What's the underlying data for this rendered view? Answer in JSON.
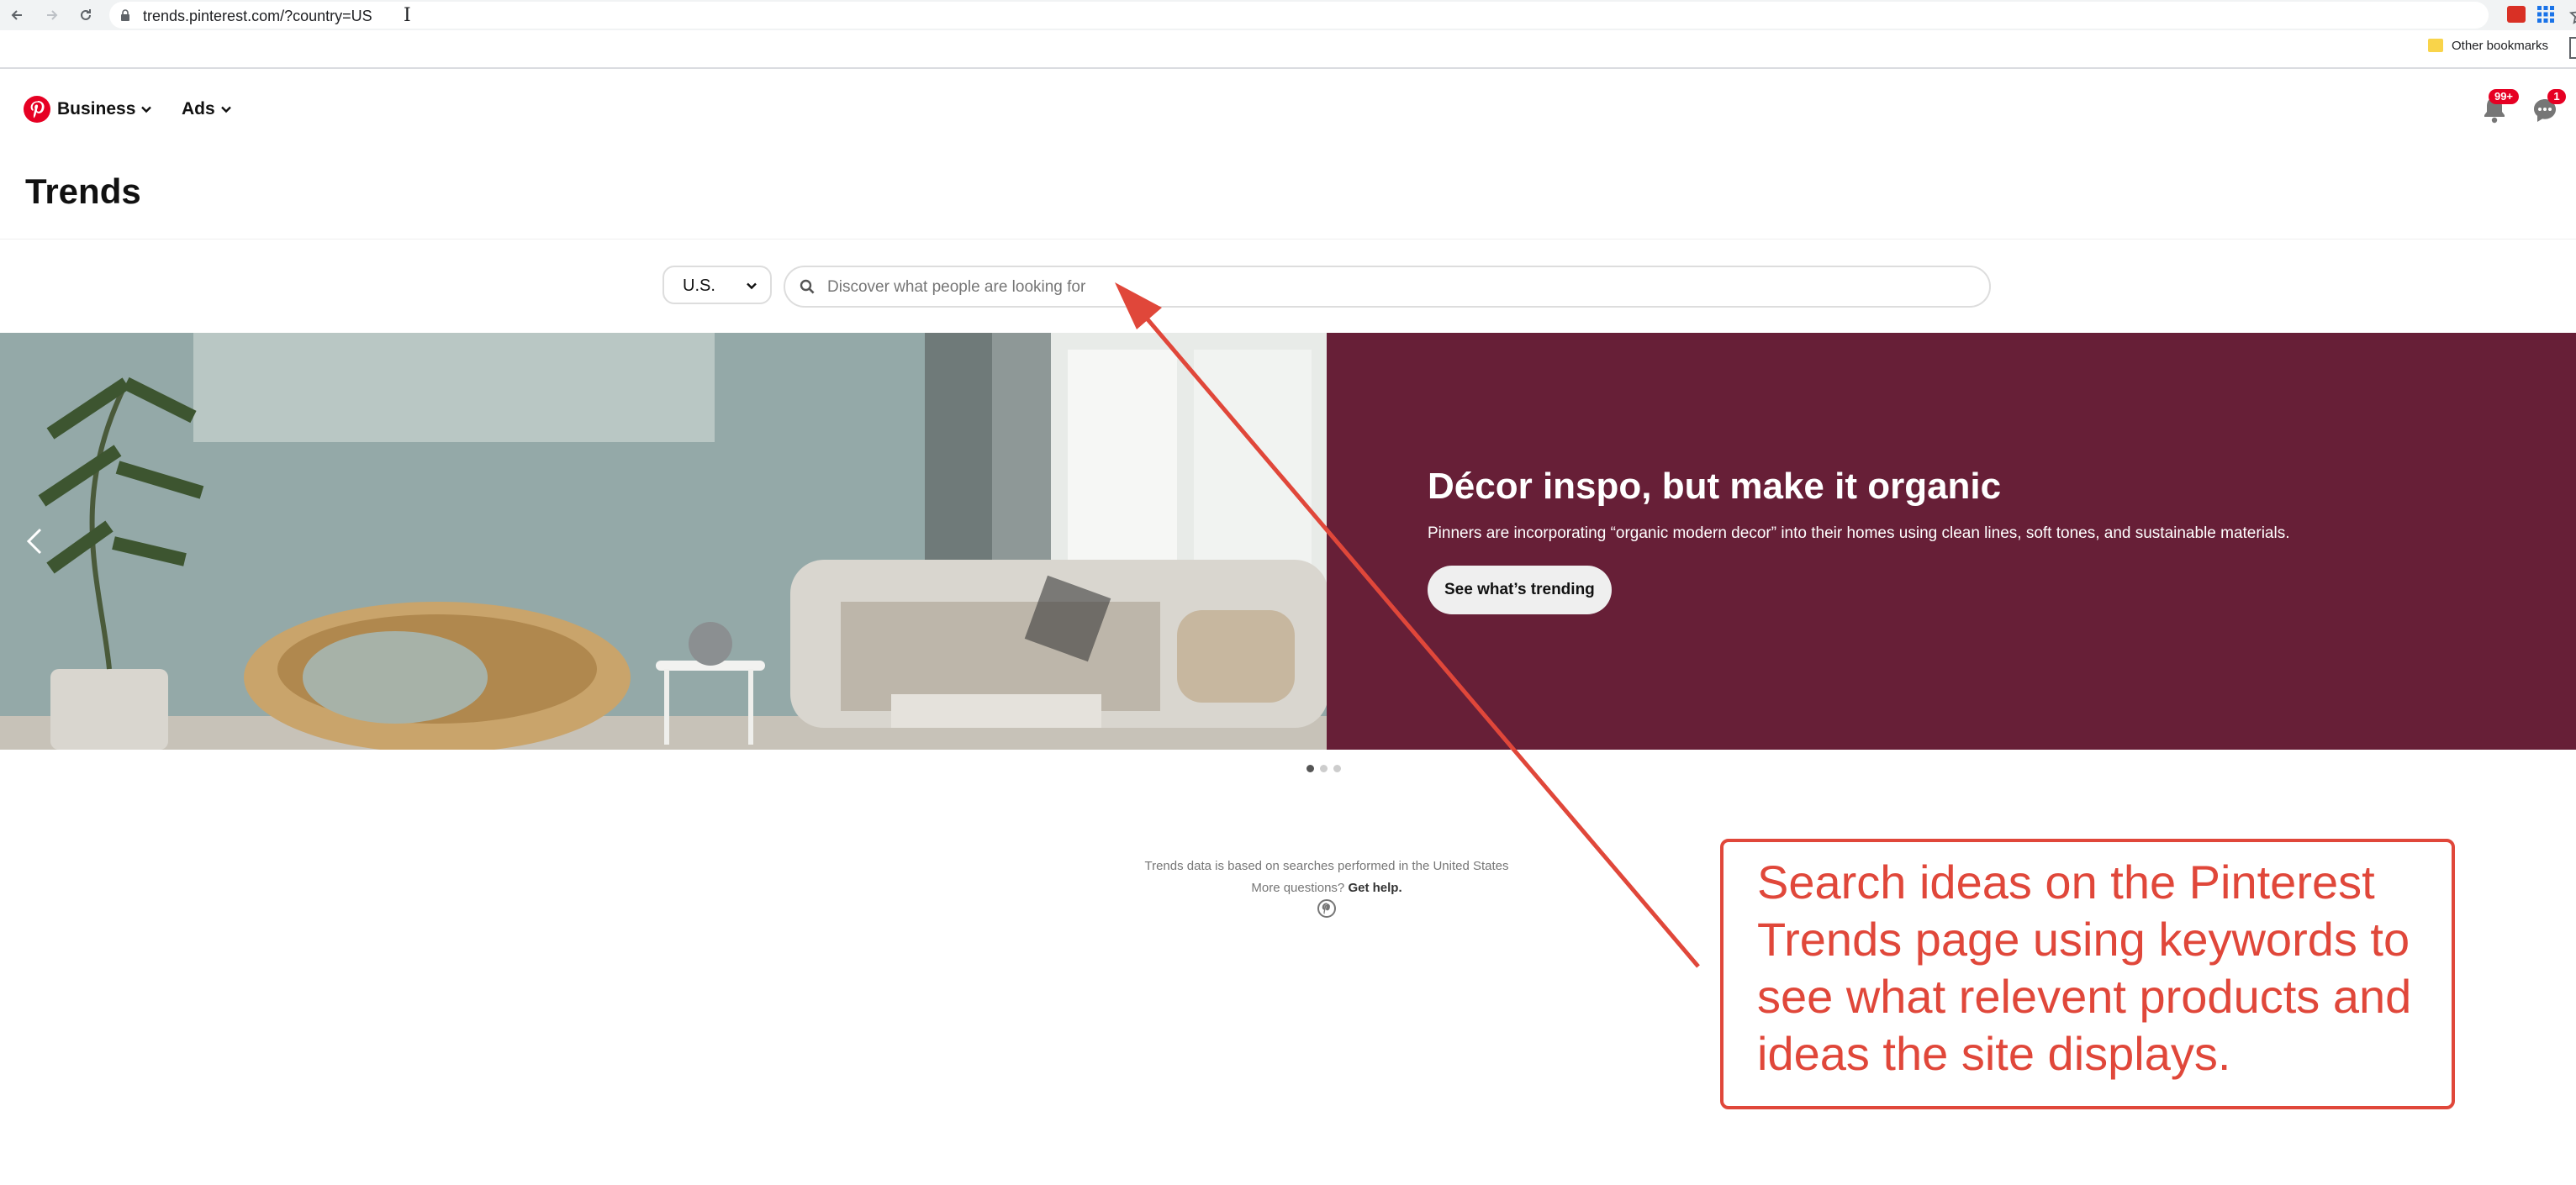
{
  "browser": {
    "url": "trends.pinterest.com/?country=US",
    "bookmarks_folder": "Other bookmarks"
  },
  "header": {
    "nav_business": "Business",
    "nav_ads": "Ads",
    "notifications_badge": "99+",
    "messages_badge": "1"
  },
  "page_title": "Trends",
  "search": {
    "country": "U.S.",
    "placeholder": "Discover what people are looking for"
  },
  "hero": {
    "title": "Décor inspo, but make it organic",
    "description": "Pinners are incorporating “organic modern decor” into their homes using clean lines, soft tones, and sustainable materials.",
    "cta": "See what’s trending",
    "slide_count": 3,
    "active_slide": 1
  },
  "footer": {
    "note": "Trends data is based on searches performed in the United States",
    "help_prefix": "More questions?",
    "help_link": "Get help."
  },
  "annotation": {
    "text": "Search ideas on the Pinterest Trends page using keywords to see what relevent products and ideas the site displays."
  },
  "colors": {
    "pinterest_red": "#e60023",
    "hero_panel": "#671f37",
    "annotation": "#e0473a"
  }
}
